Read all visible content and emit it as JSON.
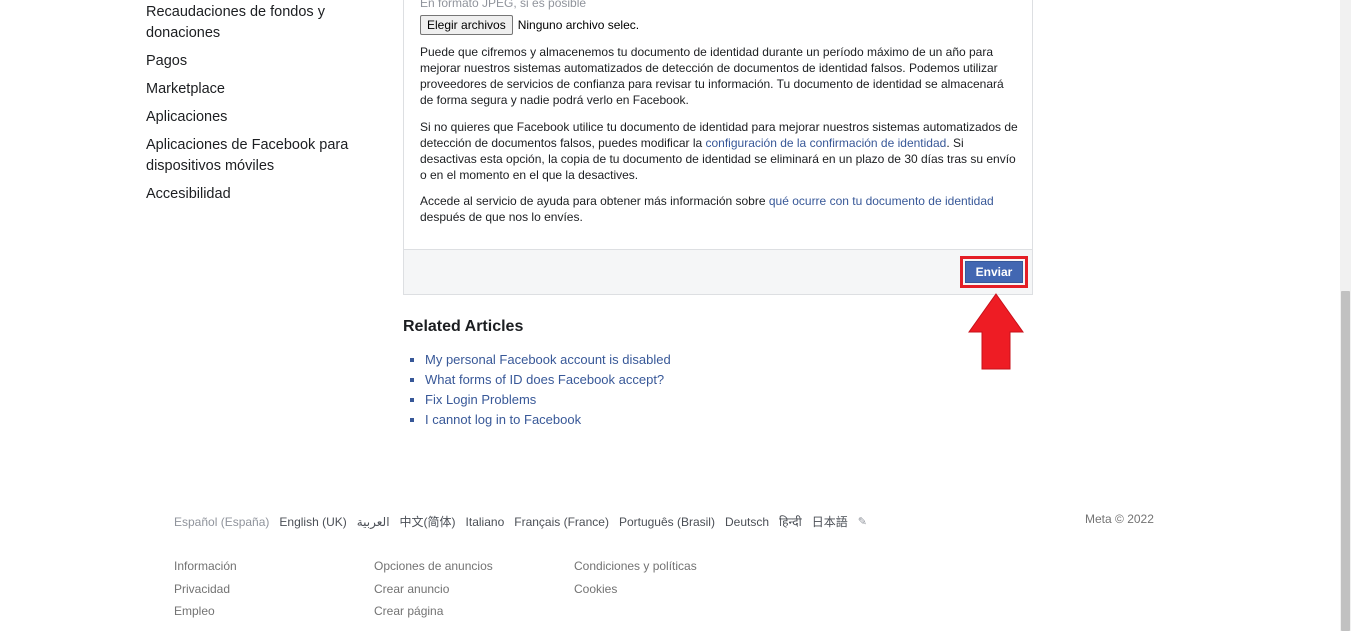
{
  "sidebar": {
    "items": [
      {
        "label": "Recaudaciones de fondos y donaciones"
      },
      {
        "label": "Pagos"
      },
      {
        "label": "Marketplace"
      },
      {
        "label": "Aplicaciones"
      },
      {
        "label": "Aplicaciones de Facebook para dispositivos móviles"
      },
      {
        "label": "Accesibilidad"
      }
    ]
  },
  "form": {
    "hint": "En formato JPEG, si es posible",
    "file_button": "Elegir archivos",
    "file_status": "Ninguno archivo selec.",
    "para1": "Puede que cifremos y almacenemos tu documento de identidad durante un período máximo de un año para mejorar nuestros sistemas automatizados de detección de documentos de identidad falsos. Podemos utilizar proveedores de servicios de confianza para revisar tu información. Tu documento de identidad se almacenará de forma segura y nadie podrá verlo en Facebook.",
    "para2_before": "Si no quieres que Facebook utilice tu documento de identidad para mejorar nuestros sistemas automatizados de detección de documentos falsos, puedes modificar la ",
    "para2_link": "configuración de la confirmación de identidad",
    "para2_after": ". Si desactivas esta opción, la copia de tu documento de identidad se eliminará en un plazo de 30 días tras su envío o en el momento en el que la desactives.",
    "para3_before": "Accede al servicio de ayuda para obtener más información sobre ",
    "para3_link": "qué ocurre con tu documento de identidad",
    "para3_after": " después de que nos lo envíes.",
    "submit": "Enviar"
  },
  "related": {
    "title": "Related Articles",
    "items": [
      {
        "label": "My personal Facebook account is disabled"
      },
      {
        "label": "What forms of ID does Facebook accept?"
      },
      {
        "label": "Fix Login Problems"
      },
      {
        "label": "I cannot log in to Facebook"
      }
    ]
  },
  "footer": {
    "languages": [
      "Español (España)",
      "English (UK)",
      "العربية",
      "中文(简体)",
      "Italiano",
      "Français (France)",
      "Português (Brasil)",
      "Deutsch",
      "हिन्दी",
      "日本語"
    ],
    "copyright": "Meta © 2022",
    "col1": [
      "Información",
      "Privacidad",
      "Empleo"
    ],
    "col2": [
      "Opciones de anuncios",
      "Crear anuncio",
      "Crear página"
    ],
    "col3": [
      "Condiciones y políticas",
      "Cookies"
    ]
  },
  "colors": {
    "link": "#385898",
    "button": "#4267b2",
    "highlight": "#e41e26"
  }
}
